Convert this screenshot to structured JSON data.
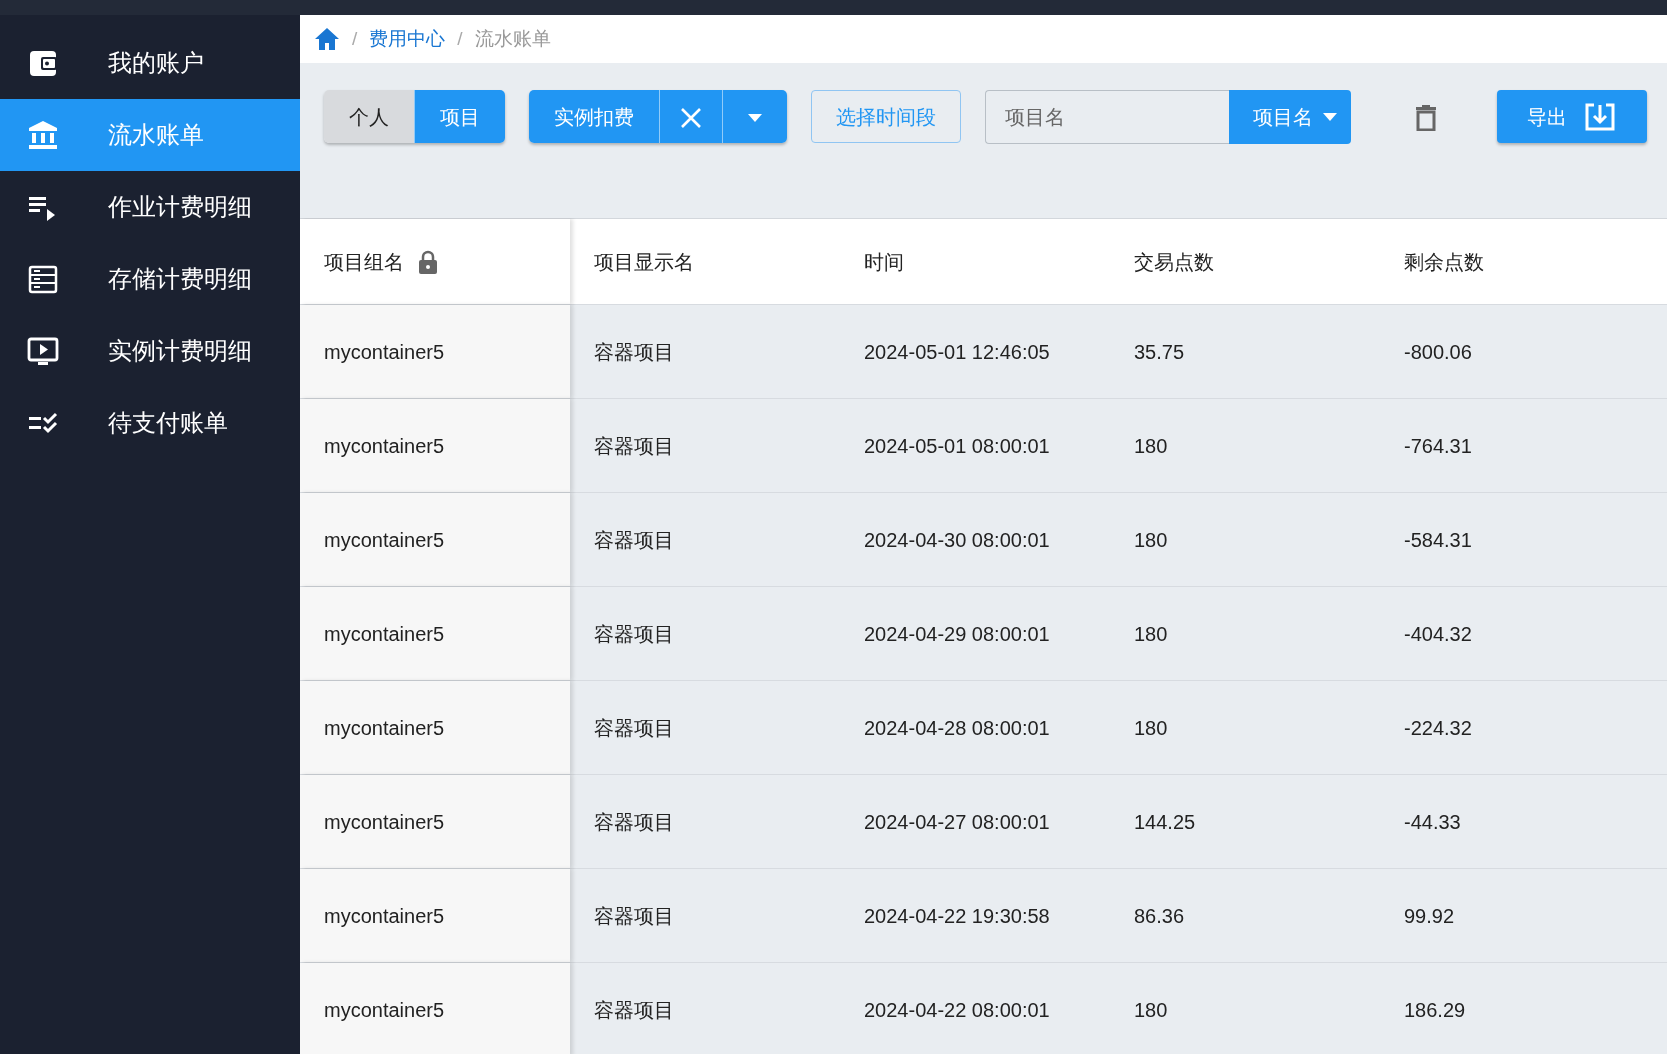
{
  "sidebar": {
    "items": [
      {
        "label": "我的账户",
        "kind": "wallet",
        "selected": false
      },
      {
        "label": "流水账单",
        "kind": "bank",
        "selected": true
      },
      {
        "label": "作业计费明细",
        "kind": "playlist",
        "selected": false
      },
      {
        "label": "存储计费明细",
        "kind": "storage",
        "selected": false
      },
      {
        "label": "实例计费明细",
        "kind": "monitor",
        "selected": false
      },
      {
        "label": "待支付账单",
        "kind": "checklist",
        "selected": false
      }
    ]
  },
  "breadcrumb": {
    "separator": "/",
    "items": [
      "费用中心",
      "流水账单"
    ]
  },
  "toolbar": {
    "scope_toggle": [
      {
        "label": "个人",
        "selected": false
      },
      {
        "label": "项目",
        "selected": true
      }
    ],
    "type_filter": {
      "label": "实例扣费"
    },
    "time_range_button": "选择时间段",
    "search": {
      "placeholder": "项目名"
    },
    "search_field_select": "项目名",
    "export_button": "导出"
  },
  "table": {
    "columns": [
      "项目组名",
      "项目显示名",
      "时间",
      "交易点数",
      "剩余点数"
    ],
    "rows": [
      [
        "mycontainer5",
        "容器项目",
        "2024-05-01 12:46:05",
        "35.75",
        "-800.06"
      ],
      [
        "mycontainer5",
        "容器项目",
        "2024-05-01 08:00:01",
        "180",
        "-764.31"
      ],
      [
        "mycontainer5",
        "容器项目",
        "2024-04-30 08:00:01",
        "180",
        "-584.31"
      ],
      [
        "mycontainer5",
        "容器项目",
        "2024-04-29 08:00:01",
        "180",
        "-404.32"
      ],
      [
        "mycontainer5",
        "容器项目",
        "2024-04-28 08:00:01",
        "180",
        "-224.32"
      ],
      [
        "mycontainer5",
        "容器项目",
        "2024-04-27 08:00:01",
        "144.25",
        "-44.33"
      ],
      [
        "mycontainer5",
        "容器项目",
        "2024-04-22 19:30:58",
        "86.36",
        "99.92"
      ],
      [
        "mycontainer5",
        "容器项目",
        "2024-04-22 08:00:01",
        "180",
        "186.29"
      ]
    ]
  }
}
